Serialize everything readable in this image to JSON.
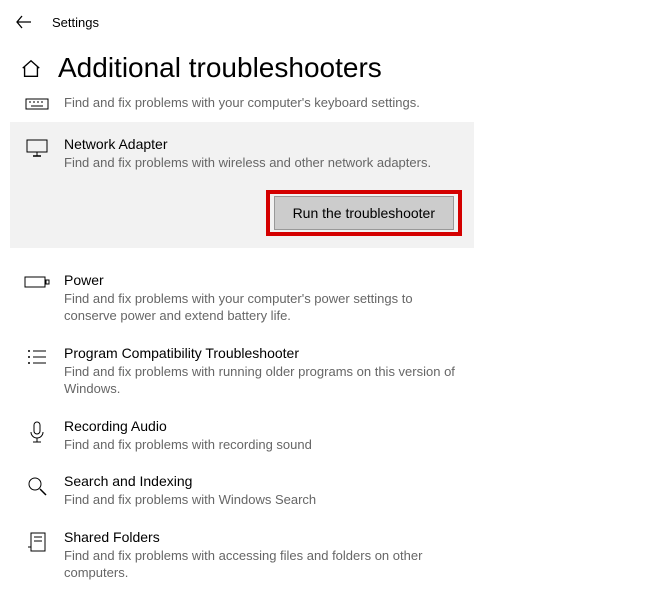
{
  "header": {
    "app_name": "Settings"
  },
  "page": {
    "title": "Additional troubleshooters"
  },
  "items": {
    "keyboard": {
      "title": "",
      "desc": "Find and fix problems with your computer's keyboard settings."
    },
    "network": {
      "title": "Network Adapter",
      "desc": "Find and fix problems with wireless and other network adapters.",
      "button": "Run the troubleshooter"
    },
    "power": {
      "title": "Power",
      "desc": "Find and fix problems with your computer's power settings to conserve power and extend battery life."
    },
    "compat": {
      "title": "Program Compatibility Troubleshooter",
      "desc": "Find and fix problems with running older programs on this version of Windows."
    },
    "recording": {
      "title": "Recording Audio",
      "desc": "Find and fix problems with recording sound"
    },
    "search": {
      "title": "Search and Indexing",
      "desc": "Find and fix problems with Windows Search"
    },
    "shared": {
      "title": "Shared Folders",
      "desc": "Find and fix problems with accessing files and folders on other computers."
    }
  }
}
